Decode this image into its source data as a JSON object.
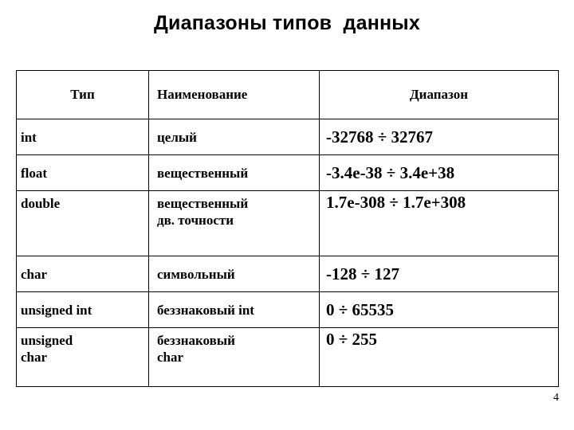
{
  "slide": {
    "title": "Диапазоны типов  данных",
    "page_number": "4"
  },
  "table": {
    "headers": {
      "type": "Тип",
      "name": "Наименование",
      "range": "Диапазон"
    },
    "rows": [
      {
        "type": "int",
        "name": "целый",
        "range": "-32768 ÷ 32767"
      },
      {
        "type": "float",
        "name": "вещественный",
        "range": "-3.4e-38 ÷ 3.4e+38"
      },
      {
        "type": "double",
        "name": "вещественный\nдв. точности",
        "range": "1.7e-308 ÷ 1.7e+308"
      },
      {
        "type": "char",
        "name": "символьный",
        "range": "-128 ÷ 127"
      },
      {
        "type": "unsigned int",
        "name": "беззнаковый int",
        "range": "0 ÷ 65535"
      },
      {
        "type": "unsigned\nchar",
        "name": "беззнаковый\nchar",
        "range": "0 ÷ 255"
      }
    ]
  },
  "colors": {
    "background": "#ffffff",
    "text": "#000000",
    "border": "#000000"
  }
}
